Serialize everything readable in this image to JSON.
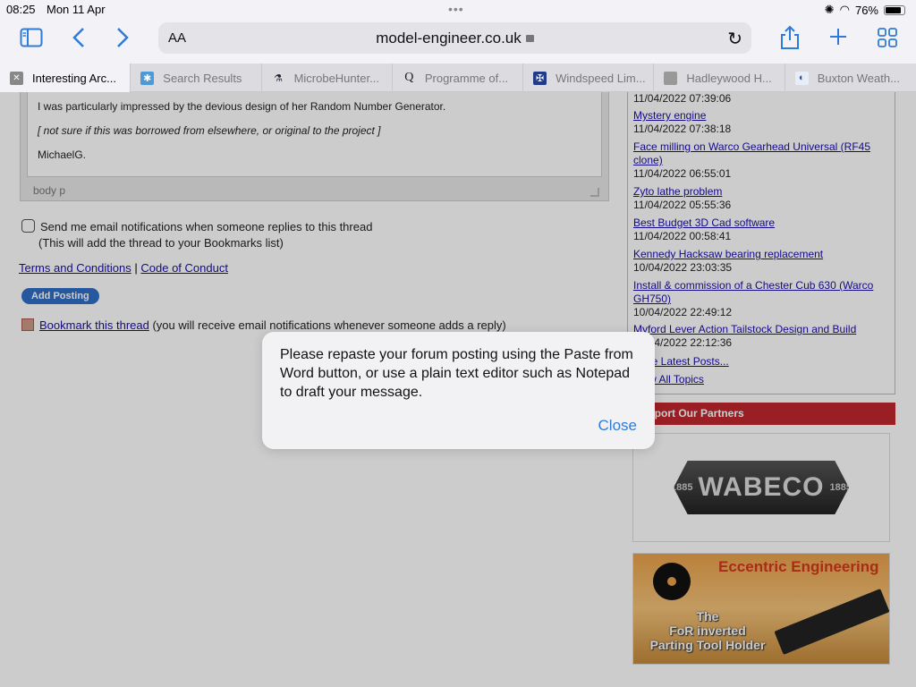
{
  "status": {
    "time": "08:25",
    "date": "Mon 11 Apr",
    "battery": "76%",
    "battery_level": 0.76
  },
  "toolbar": {
    "aa": "AA",
    "url": "model-engineer.co.uk"
  },
  "tabs": [
    {
      "label": "Interesting Arc...",
      "icon": "close-icon",
      "active": true
    },
    {
      "label": "Search Results",
      "icon": "puzzle-icon"
    },
    {
      "label": "MicrobeHunter...",
      "icon": "microscope-icon"
    },
    {
      "label": "Programme of...",
      "icon": "q-icon"
    },
    {
      "label": "Windspeed Lim...",
      "icon": "shield-icon"
    },
    {
      "label": "Hadleywood H...",
      "icon": "image-icon"
    },
    {
      "label": "Buxton Weath...",
      "icon": "weather-icon"
    }
  ],
  "editor": {
    "line1": "I was particularly impressed by the devious design of her Random Number Generator.",
    "line2": "[ not sure if this was borrowed from elsewhere, or original to the project ]",
    "line3": "MichaelG.",
    "path": "body  p"
  },
  "notify": {
    "line1": "Send me email notifications when someone replies to this thread",
    "line2": "(This will add the thread to your Bookmarks list)"
  },
  "links": {
    "terms": "Terms and Conditions",
    "sep": "|",
    "conduct": "Code of Conduct"
  },
  "add_button": "Add Posting",
  "bookmark": {
    "link": "Bookmark this thread",
    "rest": "(you will receive email notifications whenever someone adds a reply)"
  },
  "recent": [
    {
      "date": "11/04/2022 07:39:06"
    },
    {
      "title": "Mystery engine",
      "date": "11/04/2022 07:38:18"
    },
    {
      "title": "Face milling on Warco Gearhead Universal (RF45 clone)",
      "date": "11/04/2022 06:55:01"
    },
    {
      "title": "Zyto lathe problem",
      "date": "11/04/2022 05:55:36"
    },
    {
      "title": "Best Budget 3D Cad software",
      "date": "11/04/2022 00:58:41"
    },
    {
      "title": "Kennedy Hacksaw bearing replacement",
      "date": "10/04/2022 23:03:35"
    },
    {
      "title": "Install & commission of a Chester Cub 630 (Warco GH750)",
      "date": "10/04/2022 22:49:12"
    },
    {
      "title": "Myford Lever Action Tailstock Design and Build",
      "date": "10/04/2022 22:12:36"
    }
  ],
  "more_links": {
    "latest": "More Latest Posts...",
    "all_topics": "View All Topics"
  },
  "partners": {
    "header": "Support Our Partners",
    "wabeco": {
      "name": "WABECO",
      "year": "1885"
    },
    "eccentric": {
      "title": "Eccentric Engineering",
      "line1": "The",
      "line2": "FoR inverted",
      "line3": "Parting Tool Holder"
    }
  },
  "alert": {
    "message": "Please repaste your forum posting using the Paste from Word button, or use a plain text editor such as Notepad to draft your message.",
    "close": "Close"
  }
}
